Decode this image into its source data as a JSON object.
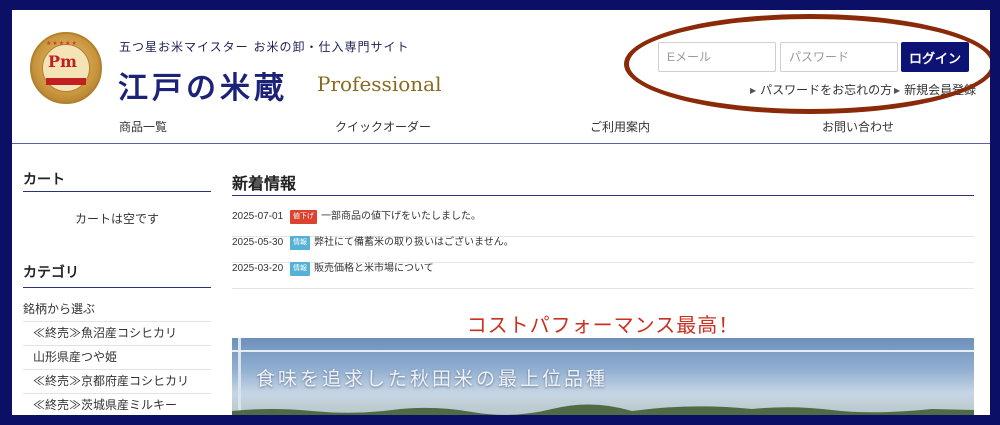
{
  "header": {
    "tagline": "五つ星お米マイスター お米の卸・仕入専門サイト",
    "brand": "江戸の米蔵",
    "brand_sub": "Professional",
    "logo": {
      "initials": "Pm",
      "stars": "★★★★★"
    }
  },
  "login": {
    "email_placeholder": "Eメール",
    "password_placeholder": "パスワード",
    "login_label": "ログイン",
    "forgot_label": "パスワードをお忘れの方",
    "register_label": "新規会員登録"
  },
  "nav": {
    "items": [
      "商品一覧",
      "クイックオーダー",
      "ご利用案内",
      "お問い合わせ"
    ]
  },
  "sidebar": {
    "cart_heading": "カート",
    "cart_empty": "カートは空です",
    "category_heading": "カテゴリ",
    "brand_select": "銘柄から選ぶ",
    "categories": [
      "≪終売≫魚沼産コシヒカリ",
      "山形県産つや姫",
      "≪終売≫京都府産コシヒカリ",
      "≪終売≫茨城県産ミルキー"
    ]
  },
  "news": {
    "heading": "新着情報",
    "items": [
      {
        "date": "2025-07-01",
        "badge": "値下げ",
        "badge_color": "#d9432f",
        "text": "一部商品の値下げをいたしました。"
      },
      {
        "date": "2025-05-30",
        "badge": "情報",
        "badge_color": "#55b2d6",
        "text": "弊社にて備蓄米の取り扱いはございません。"
      },
      {
        "date": "2025-03-20",
        "badge": "情報",
        "badge_color": "#55b2d6",
        "text": "販売価格と米市場について"
      }
    ]
  },
  "promo": {
    "headline": "コストパフォーマンス最高！",
    "banner_caption": "食味を追求した秋田米の最上位品種"
  },
  "colors": {
    "frame": "#0c0f66",
    "accent": "#0d1374",
    "promo_red": "#c8321e",
    "highlight_ring": "#8a2a08"
  }
}
